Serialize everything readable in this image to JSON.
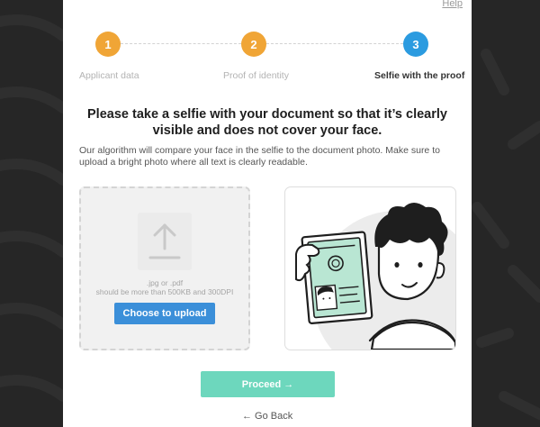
{
  "header": {
    "help_link": "Help"
  },
  "stepper": {
    "steps": [
      {
        "number": "1",
        "label": "Applicant data",
        "state": "done"
      },
      {
        "number": "2",
        "label": "Proof of identity",
        "state": "done"
      },
      {
        "number": "3",
        "label": "Selfie with the proof",
        "state": "active"
      }
    ]
  },
  "content": {
    "headline": "Please take a selfie with your document so that it’s clearly visible and does not cover your face.",
    "description": "Our algorithm will compare your face in the selfie to the document photo. Make sure to upload a bright photo where all text is clearly readable."
  },
  "upload": {
    "formats": ".jpg or .pdf",
    "requirements": "should be more than 500KB and 300DPI",
    "button_label": "Choose to upload",
    "icon": "upload-arrow-icon"
  },
  "illustration": {
    "icon": "selfie-with-document-illustration"
  },
  "footer": {
    "proceed_label": "Proceed →",
    "go_back_label": "← Go Back"
  },
  "colors": {
    "step_done": "#f0a536",
    "step_active": "#2b9be0",
    "upload_button": "#3b8fd9",
    "proceed_button": "#6dd7bd",
    "document_green": "#b9e6d3",
    "background": "#262626"
  }
}
